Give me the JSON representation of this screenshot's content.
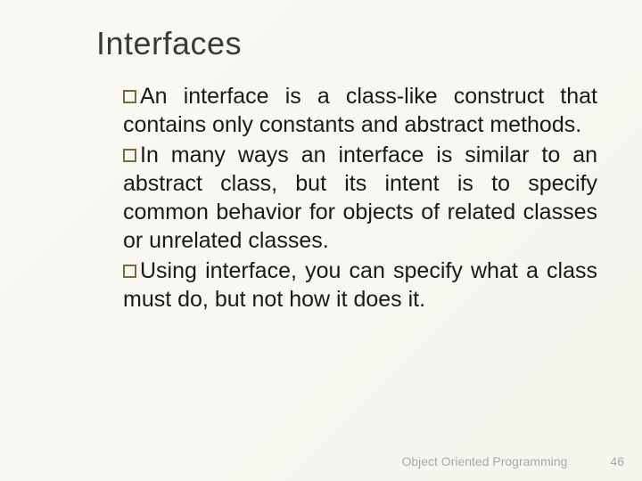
{
  "title": "Interfaces",
  "bullets": [
    {
      "parts": [
        {
          "text": "An",
          "indent": true
        },
        {
          "text": " interface is a class-like construct that contains only constants and abstract methods."
        }
      ]
    },
    {
      "parts": [
        {
          "text": "In",
          "indent": true
        },
        {
          "text": " many ways an interface is similar to an abstract class, but its intent is to specify common behavior for objects of related classes or unrelated classes."
        }
      ]
    },
    {
      "parts": [
        {
          "text": "Using",
          "indent": true
        },
        {
          "text": " interface, you can specify what a class must do, but not how it does it."
        }
      ]
    }
  ],
  "footer": {
    "label": "Object Oriented Programming",
    "page": "46"
  }
}
